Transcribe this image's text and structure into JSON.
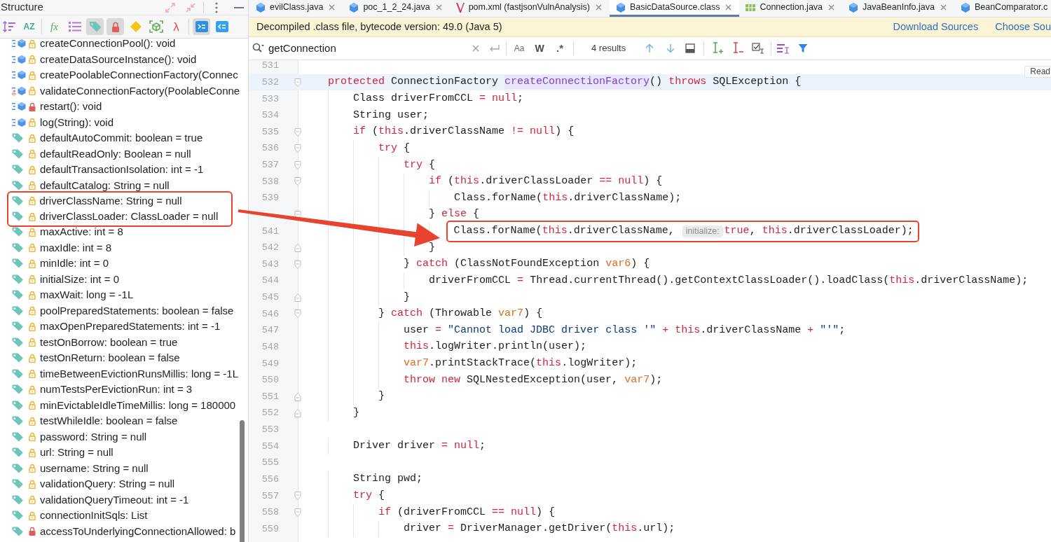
{
  "structure_panel": {
    "title": "Structure",
    "toolbar_groups": [
      [
        {
          "kind": "sort-visibility",
          "selected": false
        },
        {
          "kind": "sort-alpha",
          "label": "AZ",
          "selected": false
        }
      ],
      [
        {
          "kind": "function",
          "label": "fx",
          "selected": false
        },
        {
          "kind": "list",
          "selected": false
        },
        {
          "kind": "tag",
          "selected": true
        },
        {
          "kind": "lock",
          "selected": true
        },
        {
          "kind": "diamond",
          "selected": false
        },
        {
          "kind": "cube",
          "selected": false
        },
        {
          "kind": "lambda",
          "label": "λ",
          "selected": false
        }
      ],
      [
        {
          "kind": "tile-forward",
          "selected": true
        },
        {
          "kind": "tile-back",
          "selected": false
        }
      ]
    ],
    "items": [
      {
        "label": "createConnectionPool(): void",
        "kind": "method",
        "private": false,
        "static": false,
        "boxed": false
      },
      {
        "label": "createDataSourceInstance(): void",
        "kind": "method",
        "private": false,
        "static": false,
        "boxed": false
      },
      {
        "label": "createPoolableConnectionFactory(Connec",
        "kind": "method",
        "private": false,
        "static": false,
        "boxed": false
      },
      {
        "label": "validateConnectionFactory(PoolableConne",
        "kind": "method",
        "private": false,
        "static": true,
        "boxed": false
      },
      {
        "label": "restart(): void",
        "kind": "method",
        "private": true,
        "static": false,
        "boxed": false
      },
      {
        "label": "log(String): void",
        "kind": "method",
        "private": false,
        "static": false,
        "boxed": false
      },
      {
        "label": "defaultAutoCommit: boolean = true",
        "kind": "field",
        "private": false,
        "static": false,
        "boxed": false
      },
      {
        "label": "defaultReadOnly: Boolean = null",
        "kind": "field",
        "private": false,
        "static": false,
        "boxed": false
      },
      {
        "label": "defaultTransactionIsolation: int = -1",
        "kind": "field",
        "private": false,
        "static": false,
        "boxed": false
      },
      {
        "label": "defaultCatalog: String = null",
        "kind": "field",
        "private": false,
        "static": false,
        "boxed": false
      },
      {
        "label": "driverClassName: String = null",
        "kind": "field",
        "private": false,
        "static": false,
        "boxed": true
      },
      {
        "label": "driverClassLoader: ClassLoader = null",
        "kind": "field",
        "private": false,
        "static": false,
        "boxed": true
      },
      {
        "label": "maxActive: int = 8",
        "kind": "field",
        "private": false,
        "static": false,
        "boxed": false
      },
      {
        "label": "maxIdle: int = 8",
        "kind": "field",
        "private": false,
        "static": false,
        "boxed": false
      },
      {
        "label": "minIdle: int = 0",
        "kind": "field",
        "private": false,
        "static": false,
        "boxed": false
      },
      {
        "label": "initialSize: int = 0",
        "kind": "field",
        "private": false,
        "static": false,
        "boxed": false
      },
      {
        "label": "maxWait: long = -1L",
        "kind": "field",
        "private": false,
        "static": false,
        "boxed": false
      },
      {
        "label": "poolPreparedStatements: boolean = false",
        "kind": "field",
        "private": false,
        "static": false,
        "boxed": false
      },
      {
        "label": "maxOpenPreparedStatements: int = -1",
        "kind": "field",
        "private": false,
        "static": false,
        "boxed": false
      },
      {
        "label": "testOnBorrow: boolean = true",
        "kind": "field",
        "private": false,
        "static": false,
        "boxed": false
      },
      {
        "label": "testOnReturn: boolean = false",
        "kind": "field",
        "private": false,
        "static": false,
        "boxed": false
      },
      {
        "label": "timeBetweenEvictionRunsMillis: long = -1L",
        "kind": "field",
        "private": false,
        "static": false,
        "boxed": false
      },
      {
        "label": "numTestsPerEvictionRun: int = 3",
        "kind": "field",
        "private": false,
        "static": false,
        "boxed": false
      },
      {
        "label": "minEvictableIdleTimeMillis: long = 180000",
        "kind": "field",
        "private": false,
        "static": false,
        "boxed": false
      },
      {
        "label": "testWhileIdle: boolean = false",
        "kind": "field",
        "private": false,
        "static": false,
        "boxed": false
      },
      {
        "label": "password: String = null",
        "kind": "field",
        "private": false,
        "static": false,
        "boxed": false
      },
      {
        "label": "url: String = null",
        "kind": "field",
        "private": false,
        "static": false,
        "boxed": false
      },
      {
        "label": "username: String = null",
        "kind": "field",
        "private": false,
        "static": false,
        "boxed": false
      },
      {
        "label": "validationQuery: String = null",
        "kind": "field",
        "private": false,
        "static": false,
        "boxed": false
      },
      {
        "label": "validationQueryTimeout: int = -1",
        "kind": "field",
        "private": false,
        "static": false,
        "boxed": false
      },
      {
        "label": "connectionInitSqls: List",
        "kind": "field",
        "private": false,
        "static": false,
        "boxed": false
      },
      {
        "label": "accessToUnderlyingConnectionAllowed: b",
        "kind": "field",
        "private": true,
        "static": false,
        "boxed": false
      }
    ]
  },
  "tabs": [
    {
      "label": "evilClass.java",
      "kind": "class",
      "selected": false,
      "closable": true
    },
    {
      "label": "poc_1_2_24.java",
      "kind": "class",
      "selected": false,
      "closable": true
    },
    {
      "label": "pom.xml (fastjsonVulnAnalysis)",
      "kind": "maven",
      "selected": false,
      "closable": true
    },
    {
      "label": "BasicDataSource.class",
      "kind": "class",
      "selected": true,
      "closable": true
    },
    {
      "label": "Connection.java",
      "kind": "interface",
      "selected": false,
      "closable": true
    },
    {
      "label": "JavaBeanInfo.java",
      "kind": "class",
      "selected": false,
      "closable": true
    },
    {
      "label": "BeanComparator.c",
      "kind": "class",
      "selected": false,
      "closable": false
    }
  ],
  "banner": {
    "message": "Decompiled .class file, bytecode version: 49.0 (Java 5)",
    "links": [
      "Download Sources",
      "Choose Sou"
    ]
  },
  "search": {
    "value": "getConnection",
    "options": [
      {
        "label": "Aa",
        "selected": false
      },
      {
        "label": "W",
        "selected": false
      },
      {
        "label": ".*",
        "selected": false
      }
    ],
    "result_count": "4 results"
  },
  "editor": {
    "reader_mode": "Read",
    "lines": [
      {
        "number": "531",
        "fold_start": false,
        "fold_end": false,
        "current": false,
        "boxed": false
      },
      {
        "number": "532",
        "fold_start": true,
        "fold_end": false,
        "current": true,
        "boxed": false,
        "tokens": [
          {
            "text": "    protected",
            "kind": "keyword"
          },
          {
            "text": " ConnectionFactory ",
            "kind": "plain"
          },
          {
            "text": "createConnectionFactory",
            "kind": "declaration"
          },
          {
            "text": "() ",
            "kind": "plain"
          },
          {
            "text": "throws",
            "kind": "keyword"
          },
          {
            "text": " SQLException {",
            "kind": "plain"
          }
        ]
      },
      {
        "number": "533",
        "fold_start": false,
        "fold_end": false,
        "current": false,
        "boxed": false,
        "tokens": [
          {
            "text": "        Class driverFromCCL ",
            "kind": "plain"
          },
          {
            "text": "= null",
            "kind": "keyword"
          },
          {
            "text": ";",
            "kind": "plain"
          }
        ]
      },
      {
        "number": "534",
        "fold_start": false,
        "fold_end": false,
        "current": false,
        "boxed": false,
        "tokens": [
          {
            "text": "        String user;",
            "kind": "plain"
          }
        ]
      },
      {
        "number": "535",
        "fold_start": true,
        "fold_end": false,
        "current": false,
        "boxed": false,
        "tokens": [
          {
            "text": "        if",
            "kind": "keyword"
          },
          {
            "text": " (",
            "kind": "plain"
          },
          {
            "text": "this",
            "kind": "keyword"
          },
          {
            "text": ".driverClassName ",
            "kind": "plain"
          },
          {
            "text": "!= null",
            "kind": "keyword"
          },
          {
            "text": ") {",
            "kind": "plain"
          }
        ]
      },
      {
        "number": "536",
        "fold_start": true,
        "fold_end": false,
        "current": false,
        "boxed": false,
        "tokens": [
          {
            "text": "            try",
            "kind": "keyword"
          },
          {
            "text": " {",
            "kind": "plain"
          }
        ]
      },
      {
        "number": "537",
        "fold_start": true,
        "fold_end": false,
        "current": false,
        "boxed": false,
        "tokens": [
          {
            "text": "                try",
            "kind": "keyword"
          },
          {
            "text": " {",
            "kind": "plain"
          }
        ]
      },
      {
        "number": "538",
        "fold_start": true,
        "fold_end": false,
        "current": false,
        "boxed": false,
        "tokens": [
          {
            "text": "                    if",
            "kind": "keyword"
          },
          {
            "text": " (",
            "kind": "plain"
          },
          {
            "text": "this",
            "kind": "keyword"
          },
          {
            "text": ".driverClassLoader ",
            "kind": "plain"
          },
          {
            "text": "== null",
            "kind": "keyword"
          },
          {
            "text": ") {",
            "kind": "plain"
          }
        ]
      },
      {
        "number": "539",
        "fold_start": false,
        "fold_end": false,
        "current": false,
        "boxed": false,
        "tokens": [
          {
            "text": "                        Class.forName(",
            "kind": "plain"
          },
          {
            "text": "this",
            "kind": "keyword"
          },
          {
            "text": ".driverClassName);",
            "kind": "plain"
          }
        ]
      },
      {
        "fold_start": true,
        "fold_end": false,
        "current": false,
        "boxed": false,
        "tokens": [
          {
            "text": "                    } ",
            "kind": "plain"
          },
          {
            "text": "else",
            "kind": "keyword"
          },
          {
            "text": " {",
            "kind": "plain"
          }
        ]
      },
      {
        "number": "541",
        "fold_start": false,
        "fold_end": false,
        "current": false,
        "boxed": true,
        "tokens": [
          {
            "text": "                        Class.forName(",
            "kind": "plain"
          },
          {
            "text": "this",
            "kind": "keyword"
          },
          {
            "text": ".driverClassName, ",
            "kind": "plain"
          },
          {
            "text": "initialize:",
            "kind": "hint"
          },
          {
            "text": "true",
            "kind": "keyword"
          },
          {
            "text": ", ",
            "kind": "plain"
          },
          {
            "text": "this",
            "kind": "keyword"
          },
          {
            "text": ".driverClassLoader);",
            "kind": "plain"
          }
        ]
      },
      {
        "number": "542",
        "fold_start": false,
        "fold_end": true,
        "current": false,
        "boxed": false,
        "tokens": [
          {
            "text": "                    }",
            "kind": "plain"
          }
        ]
      },
      {
        "number": "543",
        "fold_start": true,
        "fold_end": false,
        "current": false,
        "boxed": false,
        "tokens": [
          {
            "text": "                } ",
            "kind": "plain"
          },
          {
            "text": "catch",
            "kind": "keyword"
          },
          {
            "text": " (ClassNotFoundException ",
            "kind": "plain"
          },
          {
            "text": "var6",
            "kind": "variable"
          },
          {
            "text": ") {",
            "kind": "plain"
          }
        ]
      },
      {
        "number": "544",
        "fold_start": false,
        "fold_end": false,
        "current": false,
        "boxed": false,
        "tokens": [
          {
            "text": "                    driverFromCCL ",
            "kind": "plain"
          },
          {
            "text": "=",
            "kind": "keyword"
          },
          {
            "text": " Thread.currentThread().getContextClassLoader().loadClass(",
            "kind": "plain"
          },
          {
            "text": "this",
            "kind": "keyword"
          },
          {
            "text": ".driverClassName);",
            "kind": "plain"
          }
        ]
      },
      {
        "number": "545",
        "fold_start": false,
        "fold_end": true,
        "current": false,
        "boxed": false,
        "tokens": [
          {
            "text": "                }",
            "kind": "plain"
          }
        ]
      },
      {
        "number": "546",
        "fold_start": true,
        "fold_end": false,
        "current": false,
        "boxed": false,
        "tokens": [
          {
            "text": "            } ",
            "kind": "plain"
          },
          {
            "text": "catch",
            "kind": "keyword"
          },
          {
            "text": " (Throwable ",
            "kind": "plain"
          },
          {
            "text": "var7",
            "kind": "variable"
          },
          {
            "text": ") {",
            "kind": "plain"
          }
        ]
      },
      {
        "number": "547",
        "fold_start": false,
        "fold_end": false,
        "current": false,
        "boxed": false,
        "tokens": [
          {
            "text": "                user ",
            "kind": "plain"
          },
          {
            "text": "= ",
            "kind": "keyword"
          },
          {
            "text": "\"Cannot load JDBC driver class '\"",
            "kind": "string"
          },
          {
            "text": " + this",
            "kind": "keyword"
          },
          {
            "text": ".driverClassName ",
            "kind": "plain"
          },
          {
            "text": "+ ",
            "kind": "keyword"
          },
          {
            "text": "\"'\"",
            "kind": "string"
          },
          {
            "text": ";",
            "kind": "plain"
          }
        ]
      },
      {
        "number": "548",
        "fold_start": false,
        "fold_end": false,
        "current": false,
        "boxed": false,
        "tokens": [
          {
            "text": "                this",
            "kind": "keyword"
          },
          {
            "text": ".logWriter.println(user);",
            "kind": "plain"
          }
        ]
      },
      {
        "number": "549",
        "fold_start": false,
        "fold_end": false,
        "current": false,
        "boxed": false,
        "tokens": [
          {
            "text": "                var7",
            "kind": "variable"
          },
          {
            "text": ".printStackTrace(",
            "kind": "plain"
          },
          {
            "text": "this",
            "kind": "keyword"
          },
          {
            "text": ".logWriter);",
            "kind": "plain"
          }
        ]
      },
      {
        "number": "550",
        "fold_start": false,
        "fold_end": false,
        "current": false,
        "boxed": false,
        "tokens": [
          {
            "text": "                throw new",
            "kind": "keyword"
          },
          {
            "text": " SQLNestedException(user, ",
            "kind": "plain"
          },
          {
            "text": "var7",
            "kind": "variable"
          },
          {
            "text": ");",
            "kind": "plain"
          }
        ]
      },
      {
        "number": "551",
        "fold_start": false,
        "fold_end": true,
        "current": false,
        "boxed": false,
        "tokens": [
          {
            "text": "            }",
            "kind": "plain"
          }
        ]
      },
      {
        "number": "552",
        "fold_start": false,
        "fold_end": true,
        "current": false,
        "boxed": false,
        "tokens": [
          {
            "text": "        }",
            "kind": "plain"
          }
        ]
      },
      {
        "number": "553",
        "fold_start": false,
        "fold_end": false,
        "current": false,
        "boxed": false
      },
      {
        "number": "554",
        "fold_start": false,
        "fold_end": false,
        "current": false,
        "boxed": false,
        "tokens": [
          {
            "text": "        Driver driver ",
            "kind": "plain"
          },
          {
            "text": "= null",
            "kind": "keyword"
          },
          {
            "text": ";",
            "kind": "plain"
          }
        ]
      },
      {
        "number": "555",
        "fold_start": false,
        "fold_end": false,
        "current": false,
        "boxed": false
      },
      {
        "number": "556",
        "fold_start": false,
        "fold_end": false,
        "current": false,
        "boxed": false,
        "tokens": [
          {
            "text": "        String pwd;",
            "kind": "plain"
          }
        ]
      },
      {
        "number": "557",
        "fold_start": true,
        "fold_end": false,
        "current": false,
        "boxed": false,
        "tokens": [
          {
            "text": "        try",
            "kind": "keyword"
          },
          {
            "text": " {",
            "kind": "plain"
          }
        ]
      },
      {
        "number": "558",
        "fold_start": true,
        "fold_end": false,
        "current": false,
        "boxed": false,
        "tokens": [
          {
            "text": "            if",
            "kind": "keyword"
          },
          {
            "text": " (driverFromCCL ",
            "kind": "plain"
          },
          {
            "text": "== null",
            "kind": "keyword"
          },
          {
            "text": ") {",
            "kind": "plain"
          }
        ]
      },
      {
        "number": "559",
        "fold_start": false,
        "fold_end": false,
        "current": false,
        "boxed": false,
        "tokens": [
          {
            "text": "                driver ",
            "kind": "plain"
          },
          {
            "text": "=",
            "kind": "keyword"
          },
          {
            "text": " DriverManager.getDriver(",
            "kind": "plain"
          },
          {
            "text": "this",
            "kind": "keyword"
          },
          {
            "text": ".url);",
            "kind": "plain"
          }
        ]
      }
    ]
  }
}
